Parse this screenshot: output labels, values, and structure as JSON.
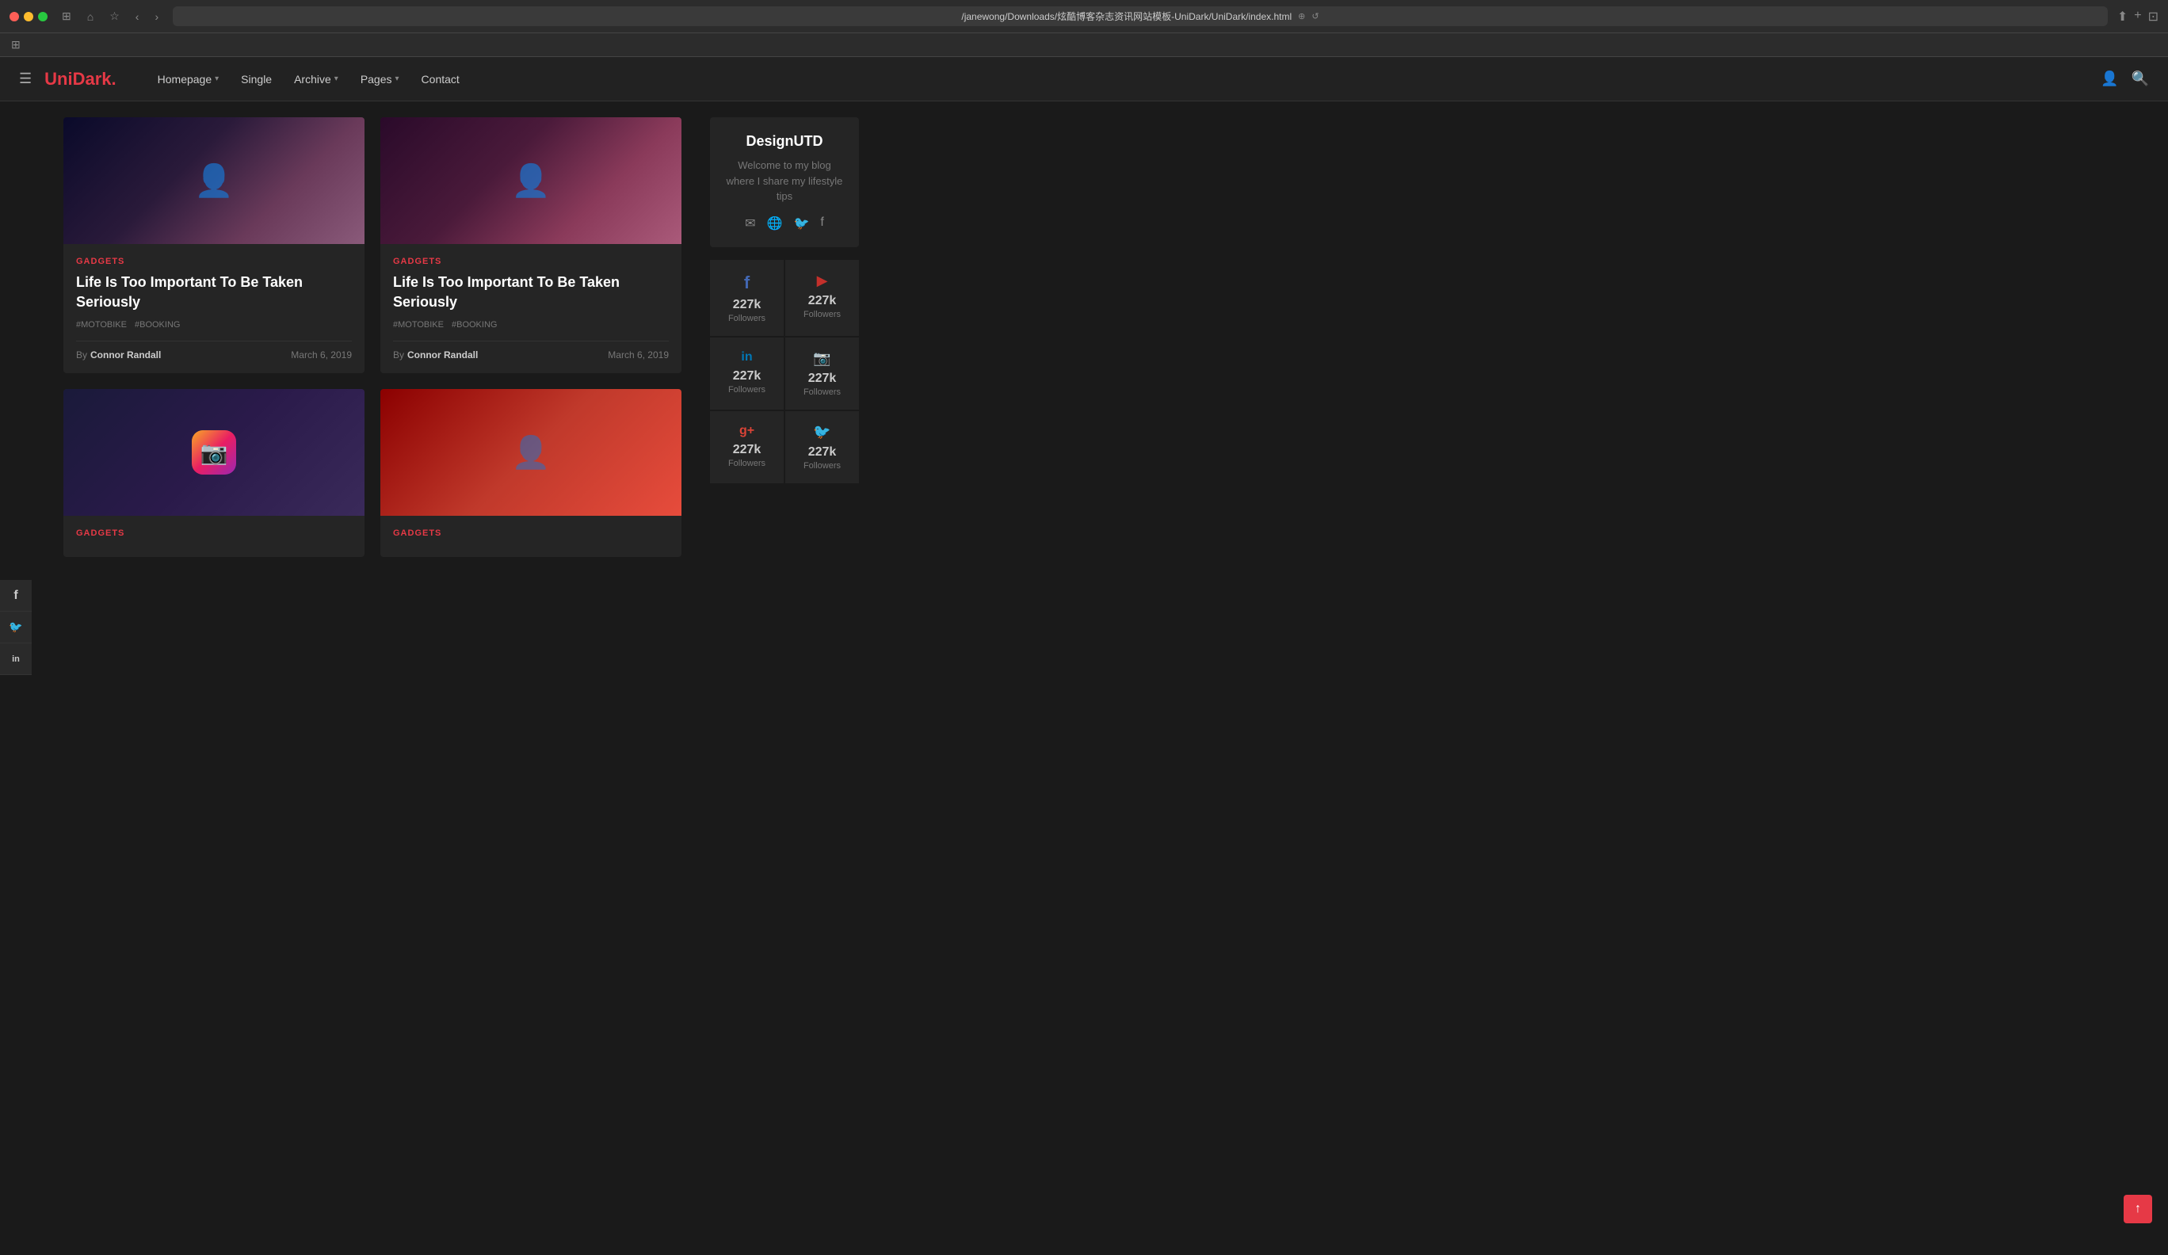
{
  "browser": {
    "url": "/janewong/Downloads/炫酷博客杂志资讯网站模板-UniDark/UniDark/index.html",
    "dots": [
      "red",
      "yellow",
      "green"
    ]
  },
  "navbar": {
    "logo_prefix": "Uni",
    "logo_suffix": "Dark.",
    "menu_items": [
      {
        "label": "Homepage",
        "has_dropdown": true
      },
      {
        "label": "Single",
        "has_dropdown": false
      },
      {
        "label": "Archive",
        "has_dropdown": true
      },
      {
        "label": "Pages",
        "has_dropdown": true
      },
      {
        "label": "Contact",
        "has_dropdown": false
      }
    ]
  },
  "social_sidebar": [
    {
      "icon": "f",
      "name": "facebook"
    },
    {
      "icon": "t",
      "name": "twitter"
    },
    {
      "icon": "in",
      "name": "linkedin"
    }
  ],
  "cards": [
    {
      "category": "GADGETS",
      "title": "Life Is Too Important To Be Taken Seriously",
      "tags": [
        "#MOTOBIKE",
        "#BOOKING"
      ],
      "author": "Connor Randall",
      "date": "March 6, 2019",
      "image_type": "person1"
    },
    {
      "category": "GADGETS",
      "title": "Life Is Too Important To Be Taken Seriously",
      "tags": [
        "#MOTOBIKE",
        "#BOOKING"
      ],
      "author": "Connor Randall",
      "date": "March 6, 2019",
      "image_type": "person2"
    },
    {
      "category": "GADGETS",
      "title": "",
      "tags": [],
      "author": "",
      "date": "",
      "image_type": "instagram"
    },
    {
      "category": "GADGETS",
      "title": "",
      "tags": [],
      "author": "",
      "date": "",
      "image_type": "fashion"
    }
  ],
  "sidebar": {
    "profile": {
      "title": "DesignUTD",
      "description": "Welcome to my blog where I share my lifestyle tips"
    },
    "social_cards": [
      {
        "network": "facebook",
        "icon": "f",
        "count": "227k",
        "label": "Followers"
      },
      {
        "network": "youtube",
        "icon": "▶",
        "count": "227k",
        "label": "Followers"
      },
      {
        "network": "linkedin",
        "icon": "in",
        "count": "227k",
        "label": "Followers"
      },
      {
        "network": "instagram",
        "icon": "◻",
        "count": "227k",
        "label": "Followers"
      },
      {
        "network": "googleplus",
        "icon": "g+",
        "count": "227k",
        "label": "Followers"
      },
      {
        "network": "twitter",
        "icon": "t",
        "count": "227k",
        "label": "Followers"
      }
    ]
  },
  "scroll_top_label": "↑",
  "by_label": "By"
}
